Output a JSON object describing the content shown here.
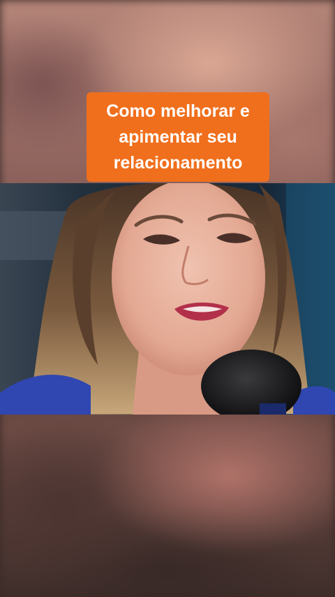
{
  "caption": {
    "text": "Como melhorar e\napimentar seu\nrelacionamento",
    "background": "#f06f1c",
    "color": "#ffffff"
  },
  "video": {
    "subject": "woman-speaking-into-microphone"
  }
}
